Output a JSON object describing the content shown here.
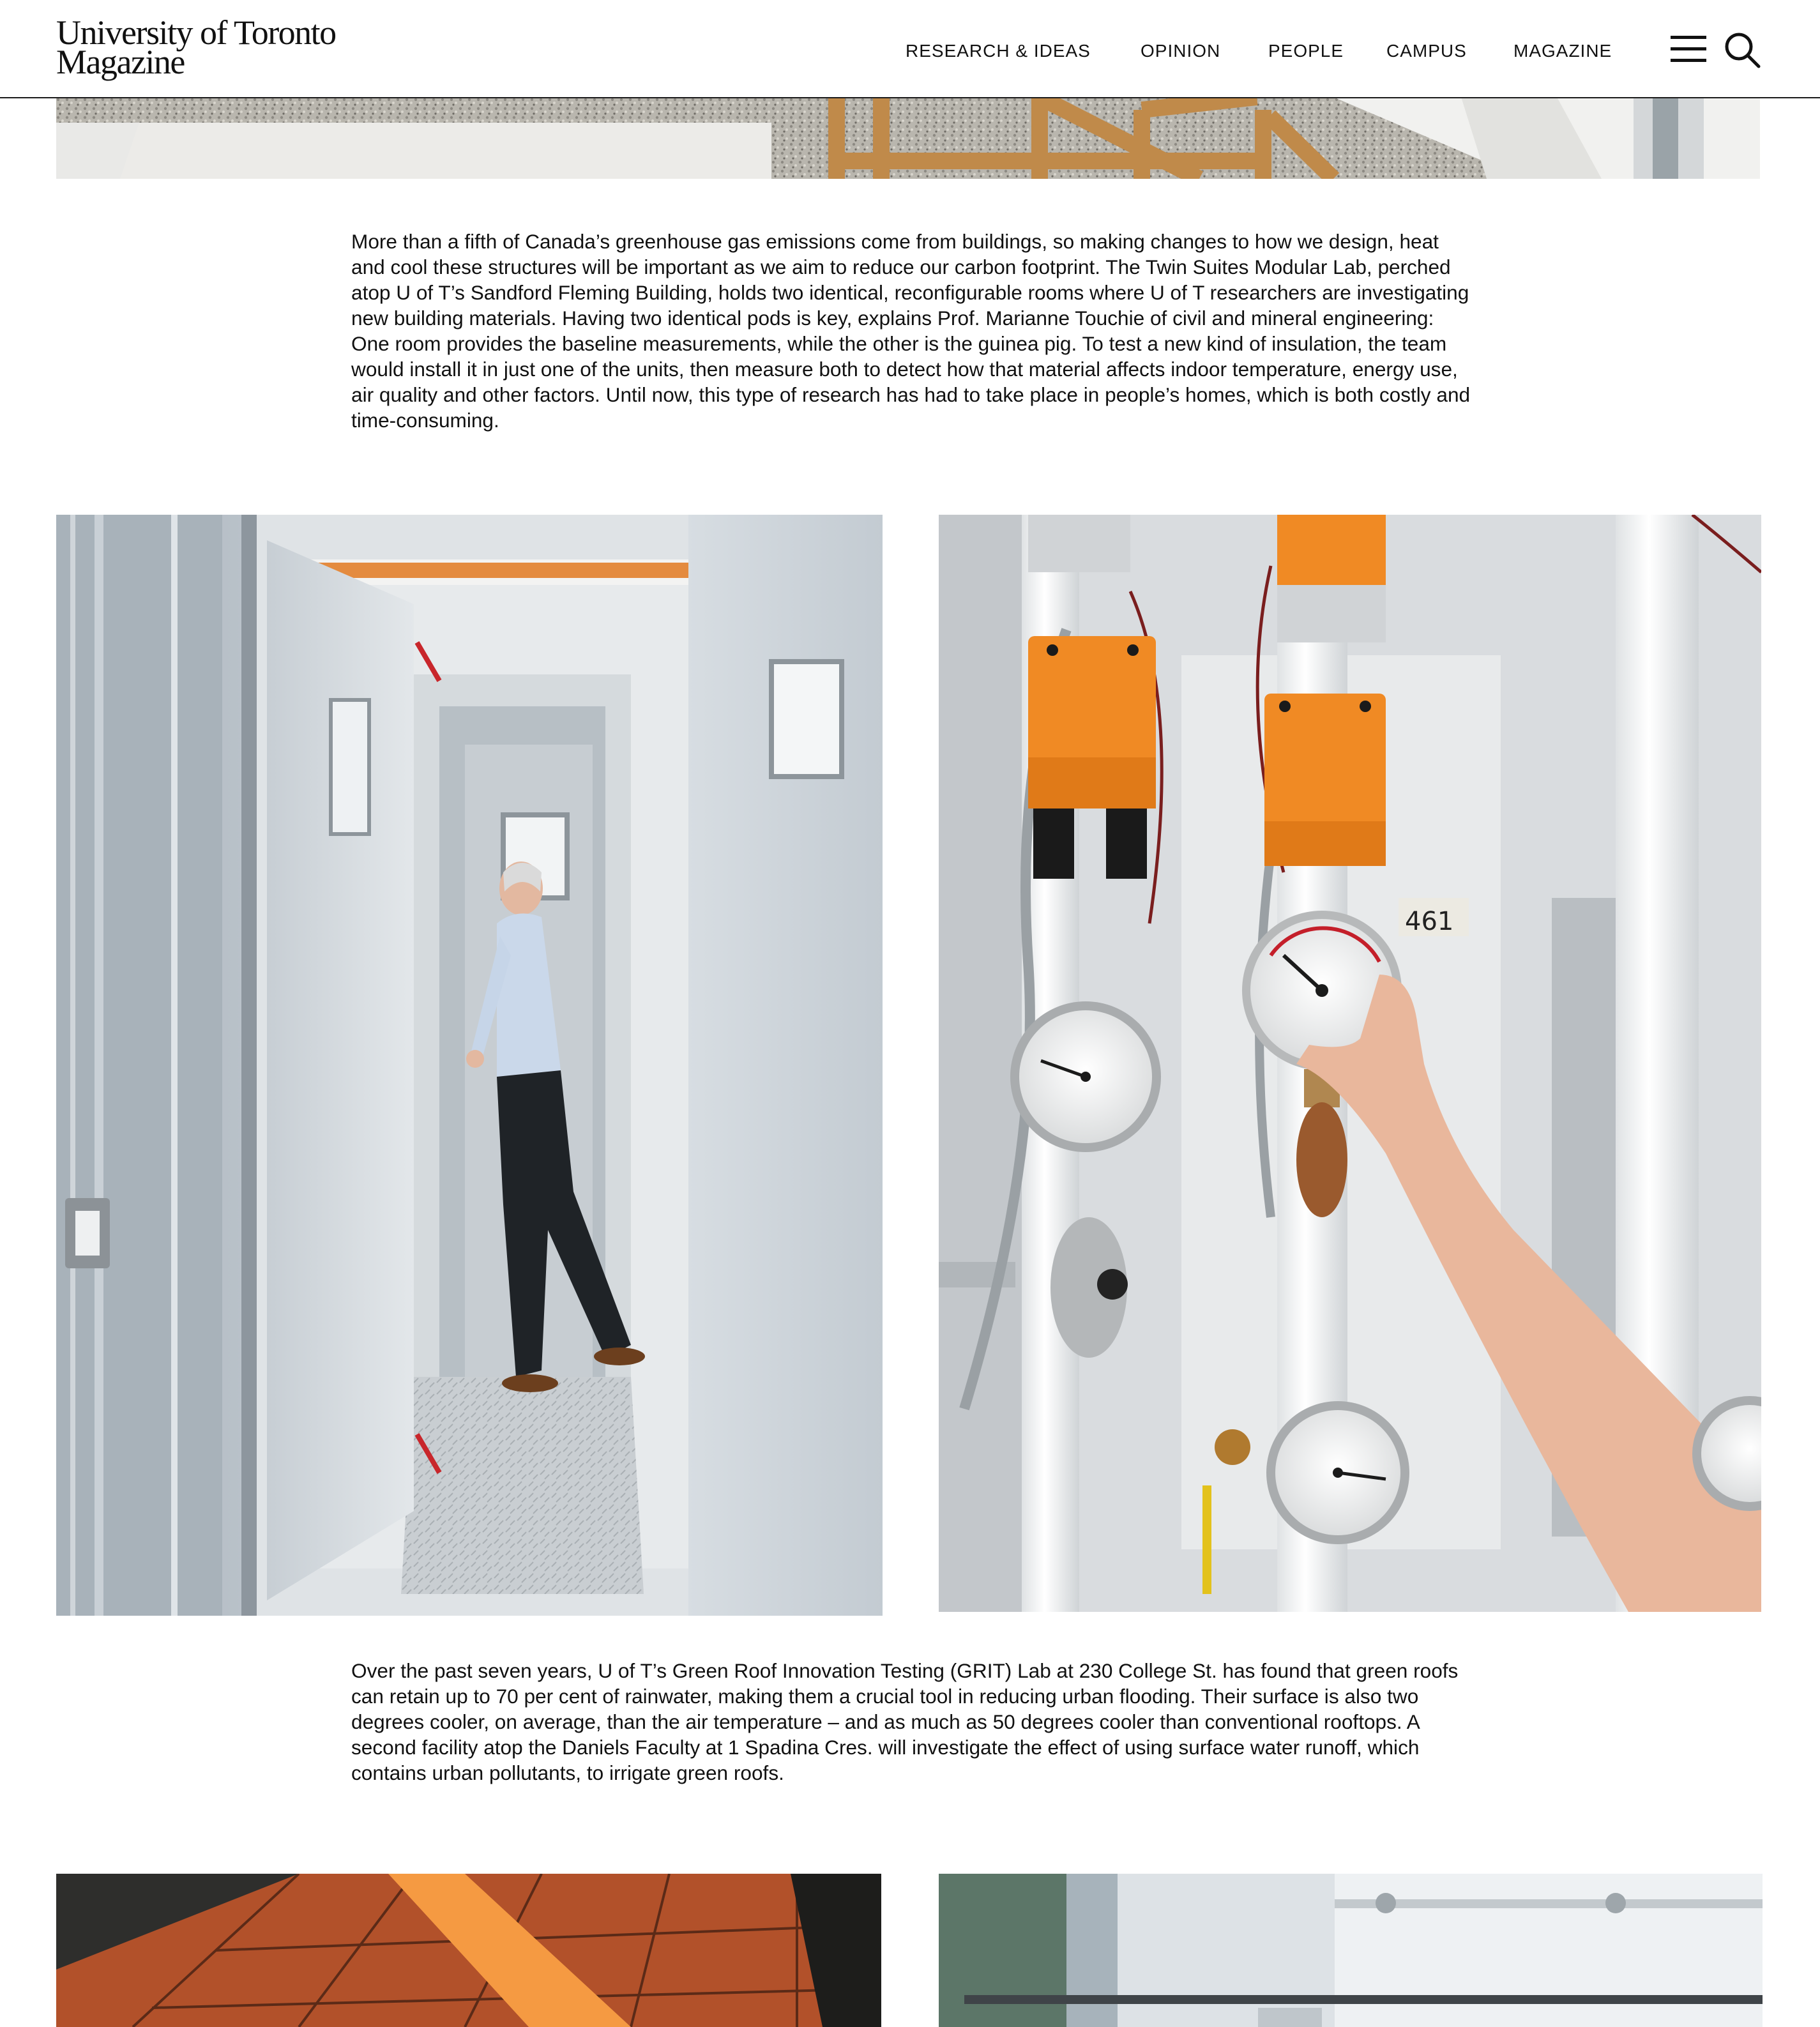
{
  "header": {
    "logo_line1": "University of Toronto",
    "logo_line2": "Magazine",
    "nav": [
      {
        "label": "RESEARCH & IDEAS"
      },
      {
        "label": "OPINION"
      },
      {
        "label": "PEOPLE"
      },
      {
        "label": "CAMPUS"
      },
      {
        "label": "MAGAZINE"
      }
    ],
    "menu_icon": "hamburger-menu-icon",
    "search_icon": "search-icon"
  },
  "article": {
    "paragraph_1": "More than a fifth of Canada’s greenhouse gas emissions come from buildings, so making changes to how we design, heat and cool these structures will be important as we aim to reduce our carbon footprint. The Twin Suites Modular Lab, perched atop U of T’s Sandford Fleming Building, holds two identical, reconfigurable rooms where U of T researchers are investigating new building materials. Having two identical pods is key, explains Prof. Marianne Touchie of civil and mineral engineering: One room provides the baseline measurements, while the other is the guinea pig. To test a new kind of insulation, the team would install it in just one of the units, then measure both to detect how that material affects indoor temperature, energy use, air quality and other factors. Until now, this type of research has had to take place in people’s homes, which is both costly and time-consuming.",
    "paragraph_2": "Over the past seven years, U of T’s Green Roof Innovation Testing (GRIT) Lab at 230 College St. has found that green roofs can retain up to 70 per cent of rainwater, making them a crucial tool in reducing urban flooding. Their surface is also two degrees cooler, on average, than the air temperature – and as much as 50 degrees cooler than conventional rooftops. A second facility atop the Daniels Faculty at 1 Spadina Cres. will investigate the effect of using surface water runoff, which contains urban pollutants, to irrigate green roofs."
  },
  "colors": {
    "text": "#111111",
    "background": "#ffffff",
    "accent_orange": "#f08a24"
  }
}
